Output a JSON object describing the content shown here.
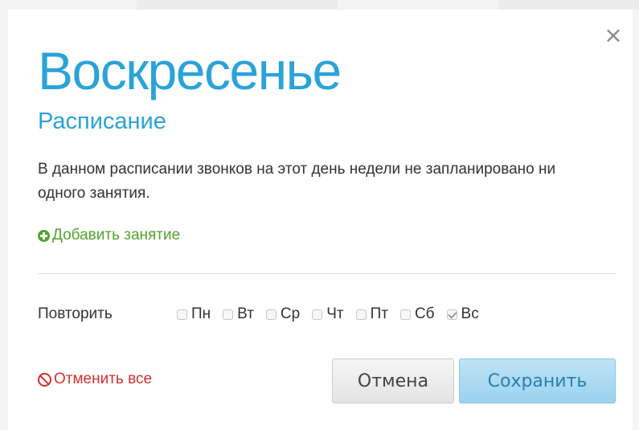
{
  "dialog": {
    "title": "Воскресенье",
    "subtitle": "Расписание",
    "message": "В данном расписании звонков на этот день недели не запланировано ни одного занятия.",
    "add_lesson_label": "Добавить занятие",
    "close_icon": "×",
    "repeat": {
      "label": "Повторить",
      "days": [
        {
          "label": "Пн",
          "checked": false
        },
        {
          "label": "Вт",
          "checked": false
        },
        {
          "label": "Ср",
          "checked": false
        },
        {
          "label": "Чт",
          "checked": false
        },
        {
          "label": "Пт",
          "checked": false
        },
        {
          "label": "Сб",
          "checked": false
        },
        {
          "label": "Вс",
          "checked": true
        }
      ]
    },
    "cancel_all_label": "Отменить все",
    "cancel_button_label": "Отмена",
    "save_button_label": "Сохранить"
  },
  "icons": {
    "close": "close-icon",
    "add": "plus-circle-icon",
    "cancel_all": "ban-icon",
    "checkbox": "checkbox-icon"
  },
  "colors": {
    "accent": "#2aa3d8",
    "add_link": "#52a32f",
    "danger": "#d32f2f",
    "text": "#333333"
  }
}
